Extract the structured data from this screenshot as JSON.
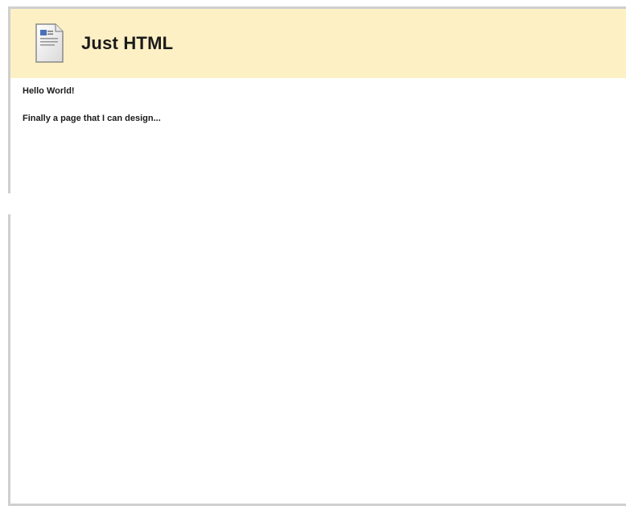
{
  "panel": {
    "title": "Just HTML",
    "icon": "html-document-icon"
  },
  "content": {
    "greeting": "Hello World!",
    "message": "Finally a page that I can design..."
  },
  "colors": {
    "header_bg": "#fdf0c4",
    "border": "#cfcfcf",
    "text": "#1a1a1a"
  }
}
